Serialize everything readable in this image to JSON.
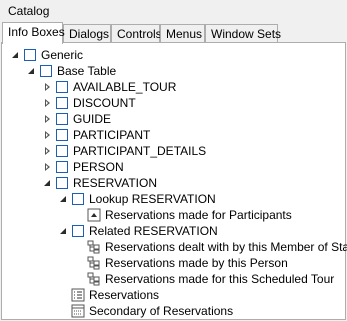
{
  "window": {
    "title": "Catalog"
  },
  "tabs": [
    "Info Boxes",
    "Dialogs",
    "Controls",
    "Menus",
    "Window Sets"
  ],
  "tree": [
    {
      "label": "Generic",
      "level": 0,
      "expander": "open",
      "icon": "checkbox"
    },
    {
      "label": "Base Table",
      "level": 1,
      "expander": "open",
      "icon": "checkbox"
    },
    {
      "label": "AVAILABLE_TOUR",
      "level": 2,
      "expander": "closed",
      "icon": "checkbox"
    },
    {
      "label": "DISCOUNT",
      "level": 2,
      "expander": "closed",
      "icon": "checkbox"
    },
    {
      "label": "GUIDE",
      "level": 2,
      "expander": "closed",
      "icon": "checkbox"
    },
    {
      "label": "PARTICIPANT",
      "level": 2,
      "expander": "closed",
      "icon": "checkbox"
    },
    {
      "label": "PARTICIPANT_DETAILS",
      "level": 2,
      "expander": "closed",
      "icon": "checkbox"
    },
    {
      "label": "PERSON",
      "level": 2,
      "expander": "closed",
      "icon": "checkbox"
    },
    {
      "label": "RESERVATION",
      "level": 2,
      "expander": "open",
      "icon": "checkbox"
    },
    {
      "label": "Lookup RESERVATION",
      "level": 3,
      "expander": "open",
      "icon": "checkbox"
    },
    {
      "label": "Reservations made for Participants",
      "level": 4,
      "expander": "none",
      "icon": "lookup-icon"
    },
    {
      "label": "Related RESERVATION",
      "level": 3,
      "expander": "open",
      "icon": "checkbox"
    },
    {
      "label": "Reservations dealt with by this Member of Staff",
      "level": 4,
      "expander": "none",
      "icon": "relation-icon"
    },
    {
      "label": "Reservations made by this Person",
      "level": 4,
      "expander": "none",
      "icon": "relation-icon"
    },
    {
      "label": "Reservations made for this Scheduled Tour",
      "level": 4,
      "expander": "none",
      "icon": "relation-icon"
    },
    {
      "label": "Reservations",
      "level": 3,
      "expander": "none",
      "icon": "list-icon"
    },
    {
      "label": "Secondary of Reservations",
      "level": 3,
      "expander": "none",
      "icon": "secondary-list-icon"
    }
  ],
  "colors": {
    "checkbox_border": "#1f5fb3",
    "background": "#f0f0f0",
    "tree_background": "#ffffff"
  }
}
